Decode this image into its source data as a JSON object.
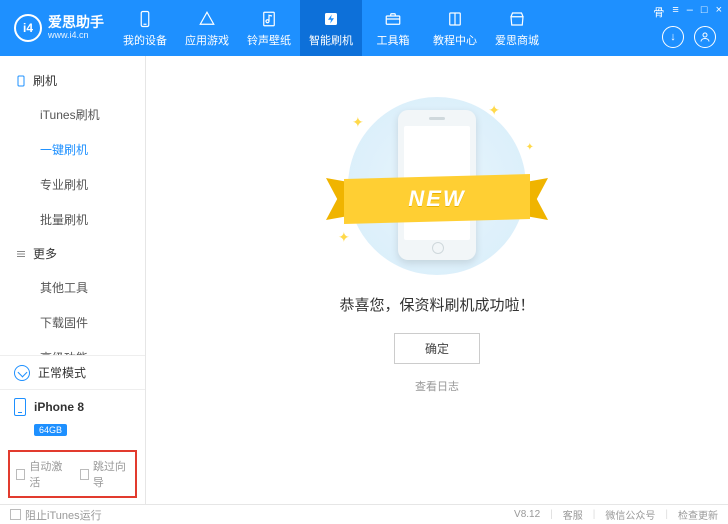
{
  "brand": {
    "logo_text": "i4",
    "title": "爱思助手",
    "url": "www.i4.cn"
  },
  "top_tabs": [
    {
      "label": "我的设备",
      "icon": "phone",
      "active": false
    },
    {
      "label": "应用游戏",
      "icon": "apps",
      "active": false
    },
    {
      "label": "铃声壁纸",
      "icon": "music",
      "active": false
    },
    {
      "label": "智能刷机",
      "icon": "flash",
      "active": true
    },
    {
      "label": "工具箱",
      "icon": "toolbox",
      "active": false
    },
    {
      "label": "教程中心",
      "icon": "book",
      "active": false
    },
    {
      "label": "爱思商城",
      "icon": "shop",
      "active": false
    }
  ],
  "win_controls": [
    "⾻",
    "≡",
    "–",
    "□",
    "×"
  ],
  "top_icons": {
    "download": "↓",
    "user": "👤"
  },
  "sidebar": {
    "groups": [
      {
        "title": "刷机",
        "icon": "phone",
        "items": [
          {
            "label": "iTunes刷机",
            "active": false
          },
          {
            "label": "一键刷机",
            "active": true
          },
          {
            "label": "专业刷机",
            "active": false
          },
          {
            "label": "批量刷机",
            "active": false
          }
        ]
      },
      {
        "title": "更多",
        "icon": "more",
        "items": [
          {
            "label": "其他工具",
            "active": false
          },
          {
            "label": "下载固件",
            "active": false
          },
          {
            "label": "高级功能",
            "active": false
          }
        ]
      }
    ],
    "mode_label": "正常模式",
    "device": {
      "name": "iPhone 8",
      "storage": "64GB"
    },
    "options": {
      "auto_activate": "自动激活",
      "skip_guide": "跳过向导"
    }
  },
  "content": {
    "ribbon_text": "NEW",
    "success_message": "恭喜您，保资料刷机成功啦！",
    "ok_button": "确定",
    "view_log": "查看日志"
  },
  "footer": {
    "block_itunes": "阻止iTunes运行",
    "version": "V8.12",
    "links": [
      "客服",
      "微信公众号",
      "检查更新"
    ]
  }
}
